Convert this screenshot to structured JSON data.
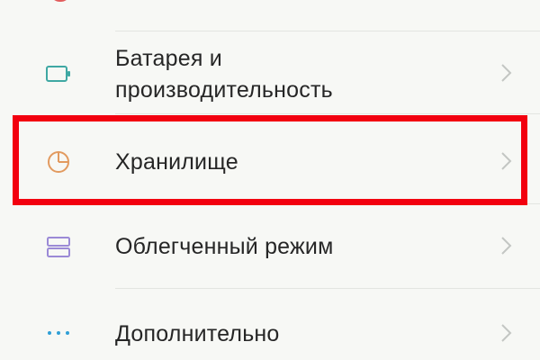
{
  "settings": {
    "items": [
      {
        "label_line1": "Батарея и",
        "label_line2": "производительность",
        "icon": "battery-icon"
      },
      {
        "label": "Хранилище",
        "icon": "pie-chart-icon"
      },
      {
        "label": "Облегченный режим",
        "icon": "stacked-rectangles-icon"
      },
      {
        "label": "Дополнительно",
        "icon": "dots-icon"
      }
    ]
  },
  "colors": {
    "battery_icon": "#3fa8a3",
    "storage_icon": "#e29a5f",
    "lite_mode_icon": "#9b8ad6",
    "dots_icon": "#2f9fd6",
    "highlight": "#f2000f",
    "chevron": "#c3c6c3"
  }
}
